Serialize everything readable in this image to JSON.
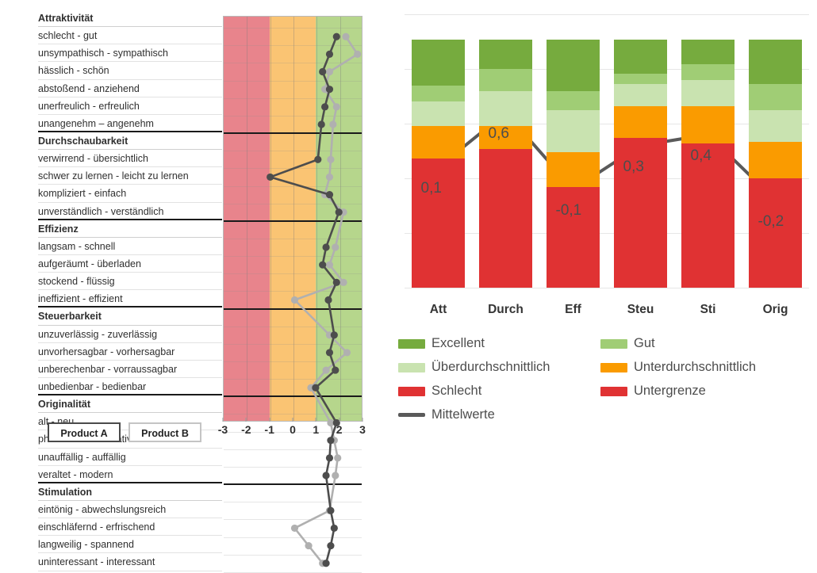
{
  "left_chart": {
    "title_axis_ticks": [
      "-3",
      "-2",
      "-1",
      "0",
      "1",
      "2",
      "3"
    ],
    "axis_min": -3,
    "axis_max": 3,
    "bands": [
      {
        "name": "negative",
        "color": "#e8848c",
        "from": -3,
        "to": -1
      },
      {
        "name": "neutral",
        "color": "#fac473",
        "from": -1,
        "to": 1
      },
      {
        "name": "positive",
        "color": "#b6d68c",
        "from": 1,
        "to": 3
      }
    ],
    "buttons": [
      {
        "label": "Product A",
        "state": "selected"
      },
      {
        "label": "Product B",
        "state": "unselected"
      }
    ],
    "groups": [
      {
        "name": "Attraktivität",
        "items": [
          {
            "label": "schlecht - gut",
            "a": 1.85,
            "b": 2.25
          },
          {
            "label": "unsympathisch - sympathisch",
            "a": 1.55,
            "b": 2.75
          },
          {
            "label": "hässlich - schön",
            "a": 1.25,
            "b": 1.55
          },
          {
            "label": "abstoßend - anziehend",
            "a": 1.55,
            "b": 1.35
          },
          {
            "label": "unerfreulich - erfreulich",
            "a": 1.35,
            "b": 1.85
          },
          {
            "label": "unangenehm – angenehm",
            "a": 1.2,
            "b": 1.7
          }
        ]
      },
      {
        "name": "Durchschaubarkeit",
        "items": [
          {
            "label": "verwirrend - übersichtlich",
            "a": 1.05,
            "b": 1.6
          },
          {
            "label": "schwer zu lernen - leicht zu lernen",
            "a": -1.0,
            "b": 1.55
          },
          {
            "label": "kompliziert - einfach",
            "a": 1.55,
            "b": 1.35
          },
          {
            "label": "unverständlich - verständlich",
            "a": 1.95,
            "b": 2.15
          }
        ]
      },
      {
        "name": "Effizienz",
        "items": [
          {
            "label": "langsam - schnell",
            "a": 1.4,
            "b": 1.8
          },
          {
            "label": "aufgeräumt - überladen",
            "a": 1.25,
            "b": 1.55
          },
          {
            "label": "stockend - flüssig",
            "a": 1.85,
            "b": 2.15
          },
          {
            "label": "ineffizient - effizient",
            "a": 1.5,
            "b": 0.05
          }
        ]
      },
      {
        "name": "Steuerbarkeit",
        "items": [
          {
            "label": "unzuverlässig - zuverlässig",
            "a": 1.75,
            "b": 1.55
          },
          {
            "label": "unvorhersagbar - vorhersagbar",
            "a": 1.55,
            "b": 2.3
          },
          {
            "label": "unberechenbar - vorraussagbar",
            "a": 1.8,
            "b": 1.4
          },
          {
            "label": "unbedienbar - bedienbar",
            "a": 0.95,
            "b": 0.75
          }
        ]
      },
      {
        "name": "Originalität",
        "items": [
          {
            "label": "alt - neu",
            "a": 1.85,
            "b": 1.6
          },
          {
            "label": "phantasielos - kreativ",
            "a": 1.6,
            "b": 1.75
          },
          {
            "label": "unauffällig - auffällig",
            "a": 1.55,
            "b": 1.9
          },
          {
            "label": "veraltet - modern",
            "a": 1.4,
            "b": 1.8
          }
        ]
      },
      {
        "name": "Stimulation",
        "items": [
          {
            "label": "eintönig - abwechslungsreich",
            "a": 1.6,
            "b": 1.55
          },
          {
            "label": "einschläfernd - erfrischend",
            "a": 1.75,
            "b": 0.05
          },
          {
            "label": "langweilig - spannend",
            "a": 1.6,
            "b": 0.65
          },
          {
            "label": "uninteressant - interessant",
            "a": 1.4,
            "b": 1.25
          }
        ]
      }
    ],
    "series_colors": {
      "product_a": "#4d4d4d",
      "product_b": "#b0b0b0"
    }
  },
  "chart_data": {
    "type": "bar",
    "subtype": "stacked-bar-with-line",
    "title": "",
    "xlabel": "",
    "ylabel": "",
    "ylim": [
      -1.0,
      1.5
    ],
    "grid": true,
    "categories": [
      "Att",
      "Durch",
      "Eff",
      "Steu",
      "Sti",
      "Orig"
    ],
    "stack_order": [
      "Untergrenze",
      "Unterdurchschnittlich",
      "Überdurchschnittlich",
      "Gut",
      "Excellent"
    ],
    "series": [
      {
        "name": "Untergrenze",
        "color": "#e03233",
        "values": [
          -1.0,
          -1.0,
          -1.0,
          -1.0,
          -1.0,
          -1.0
        ],
        "tops": [
          0.18,
          0.27,
          -0.08,
          0.37,
          0.32,
          0.0
        ]
      },
      {
        "name": "Unterdurchschnittlich",
        "color": "#fa9b00",
        "values": [
          0.0,
          0.0,
          0.0,
          0.0,
          0.0,
          0.0
        ],
        "tops": [
          0.48,
          0.48,
          0.24,
          0.66,
          0.66,
          0.33
        ]
      },
      {
        "name": "Überdurchschnittlich",
        "color": "#c9e3b0",
        "values": [
          0.0,
          0.0,
          0.0,
          0.0,
          0.0,
          0.0
        ],
        "tops": [
          0.7,
          0.8,
          0.62,
          0.86,
          0.9,
          0.62
        ]
      },
      {
        "name": "Gut",
        "color": "#a0cd75",
        "values": [
          0.0,
          0.0,
          0.0,
          0.0,
          0.0,
          0.0
        ],
        "tops": [
          0.85,
          1.0,
          0.8,
          0.96,
          1.04,
          0.86
        ]
      },
      {
        "name": "Excellent",
        "color": "#76ab3e",
        "values": [
          0.0,
          0.0,
          0.0,
          0.0,
          0.0,
          0.0
        ],
        "tops": [
          1.27,
          1.27,
          1.27,
          1.27,
          1.27,
          1.27
        ]
      }
    ],
    "mean_series": {
      "name": "Mittelwerte",
      "color": "#5a5a5a",
      "values": [
        0.1,
        0.6,
        -0.1,
        0.3,
        0.4,
        -0.2
      ],
      "labels": [
        "0,1",
        "0,6",
        "-0,1",
        "0,3",
        "0,4",
        "-0,2"
      ]
    },
    "legend": {
      "position": "bottom",
      "entries": [
        {
          "label": "Excellent",
          "color": "#76ab3e",
          "shape": "swatch"
        },
        {
          "label": "Gut",
          "color": "#a0cd75",
          "shape": "swatch"
        },
        {
          "label": "Überdurchschnittlich",
          "color": "#c9e3b0",
          "shape": "swatch"
        },
        {
          "label": "Unterdurchschnittlich",
          "color": "#fa9b00",
          "shape": "swatch"
        },
        {
          "label": "Schlecht",
          "color": "#e03233",
          "shape": "swatch"
        },
        {
          "label": "Untergrenze",
          "color": "#e03233",
          "shape": "swatch"
        },
        {
          "label": "Mittelwerte",
          "color": "#5a5a5a",
          "shape": "line"
        }
      ]
    }
  }
}
